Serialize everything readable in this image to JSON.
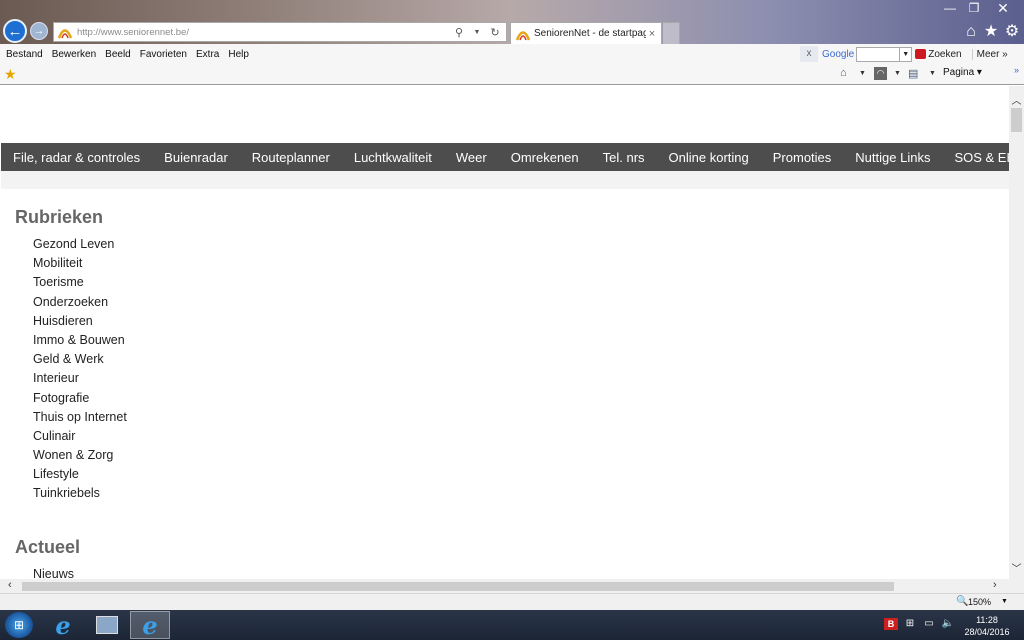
{
  "browser": {
    "address": "http://www.seniorennet.be/",
    "tab_title": "SeniorenNet - de startpagin...",
    "tab_close": "×",
    "menu": [
      "Bestand",
      "Bewerken",
      "Beeld",
      "Favorieten",
      "Extra",
      "Help"
    ],
    "google_toolbar": {
      "close": "x",
      "logo": "Google",
      "search_button": "Zoeken",
      "more": "Meer »"
    },
    "command_bar": {
      "page_label": "Pagina",
      "more": "»"
    },
    "zoom": "150%"
  },
  "site": {
    "nav": [
      "File, radar & controles",
      "Buienradar",
      "Routeplanner",
      "Luchtkwaliteit",
      "Weer",
      "Omrekenen",
      "Tel. nrs",
      "Online korting",
      "Promoties",
      "Nuttige Links",
      "SOS & EHBO"
    ],
    "sections": {
      "rubrieken": {
        "title": "Rubrieken",
        "items": [
          "Gezond Leven",
          "Mobiliteit",
          "Toerisme",
          "Onderzoeken",
          "Huisdieren",
          "Immo & Bouwen",
          "Geld & Werk",
          "Interieur",
          "Fotografie",
          "Thuis op Internet",
          "Culinair",
          "Wonen & Zorg",
          "Lifestyle",
          "Tuinkriebels"
        ]
      },
      "actueel": {
        "title": "Actueel",
        "items": [
          "Nieuws"
        ]
      }
    }
  },
  "taskbar": {
    "time": "11:28",
    "date": "28/04/2016"
  },
  "icons": {
    "back": "back-arrow-icon",
    "forward": "forward-arrow-icon",
    "home": "home-icon",
    "favorites": "star-icon",
    "settings": "gear-icon",
    "search": "search-icon",
    "refresh": "refresh-icon",
    "rss": "rss-icon",
    "print": "print-icon"
  },
  "colors": {
    "site_nav_bg": "#4d4d4d",
    "section_title": "#666666",
    "ie_blue": "#1d6fd1"
  }
}
